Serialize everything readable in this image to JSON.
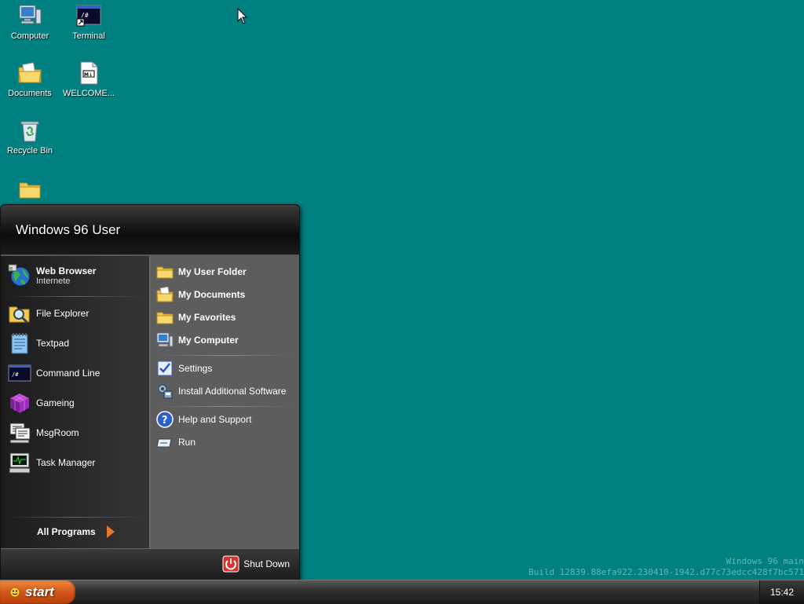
{
  "desktop": {
    "icons": [
      {
        "label": "Computer"
      },
      {
        "label": "Terminal"
      },
      {
        "label": "Documents"
      },
      {
        "label": "WELCOME..."
      },
      {
        "label": "Recycle Bin"
      },
      {
        "label": ""
      }
    ]
  },
  "watermark": {
    "line1": "Windows 96 main",
    "line2": "Build 12839.88efa922.230410-1942.d77c73edcc428f7bc571"
  },
  "start_menu": {
    "user_name": "Windows 96 User",
    "pinned": {
      "title": "Web Browser",
      "subtitle": "Internete"
    },
    "left_items": [
      {
        "label": "File Explorer"
      },
      {
        "label": "Textpad"
      },
      {
        "label": "Command Line"
      },
      {
        "label": "Gameing"
      },
      {
        "label": "MsgRoom"
      },
      {
        "label": "Task Manager"
      }
    ],
    "all_programs": "All Programs",
    "right_items": [
      {
        "label": "My User Folder"
      },
      {
        "label": "My Documents"
      },
      {
        "label": "My Favorites"
      },
      {
        "label": "My Computer"
      },
      {
        "label": "Settings"
      },
      {
        "label": "Install Additional Software"
      },
      {
        "label": "Help and Support"
      },
      {
        "label": "Run"
      }
    ],
    "shutdown": "Shut Down"
  },
  "taskbar": {
    "start_label": "start",
    "clock": "15:42"
  },
  "colors": {
    "desktop": "#008080",
    "start_button": "#d3561a",
    "shutdown": "#d9342b"
  }
}
